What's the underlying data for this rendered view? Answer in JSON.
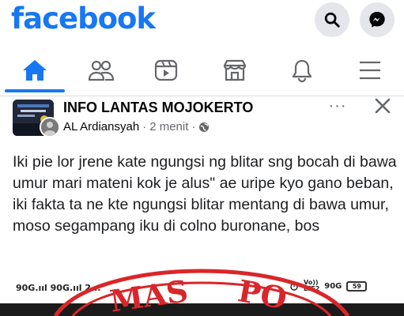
{
  "header": {
    "logo": "facebook",
    "search_icon": "search-icon",
    "messenger_icon": "messenger-icon",
    "brand_color": "#1877f2"
  },
  "nav": {
    "items": [
      {
        "name": "home",
        "icon": "home-icon",
        "active": true
      },
      {
        "name": "friends",
        "icon": "friends-icon",
        "active": false
      },
      {
        "name": "watch",
        "icon": "video-icon",
        "active": false
      },
      {
        "name": "marketplace",
        "icon": "marketplace-icon",
        "active": false
      },
      {
        "name": "notifications",
        "icon": "bell-icon",
        "active": false
      },
      {
        "name": "menu",
        "icon": "hamburger-icon",
        "active": false
      }
    ]
  },
  "post": {
    "group_name": "INFO LANTAS MOJOKERTO",
    "author": "AL Ardiansyah",
    "separator": "·",
    "time": "2 menit",
    "audience_icon": "globe-icon",
    "more_label": "···",
    "text": "Iki pie lor jrene kate ngungsi ng blitar sng bocah di bawa umur mari mateni kok je alus\" ae uripe kyo gano beban, iki fakta ta ne kte ngungsi blitar mentang di bawa umur, moso segampang iku di colno buronane, bos"
  },
  "embed": {
    "status_left": "90G.ııl 90G.ııl 2...",
    "status_right_volte": "Vo))\nLTE2",
    "status_right_net": "90G",
    "battery": "59",
    "stamp_text": "MAS PO",
    "stamp_color": "#d9262a"
  }
}
